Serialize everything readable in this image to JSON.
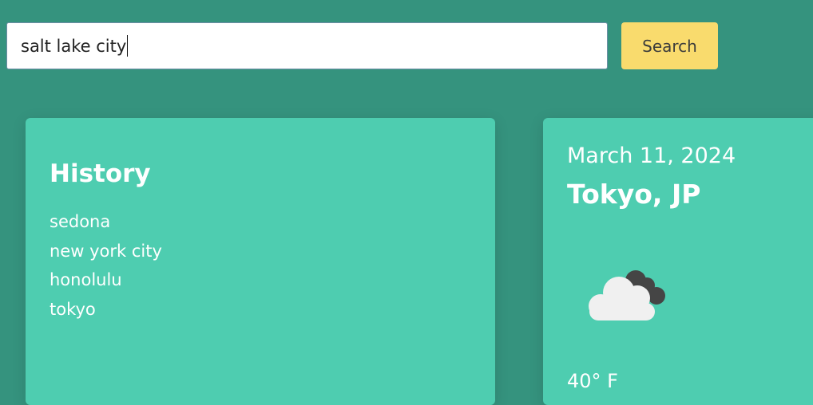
{
  "search": {
    "value": "salt lake city",
    "button_label": "Search"
  },
  "history": {
    "title": "History",
    "items": [
      "sedona",
      "new york city",
      "honolulu",
      "tokyo"
    ]
  },
  "weather": {
    "date": "March 11, 2024",
    "city": "Tokyo, JP",
    "icon": "cloudy-icon",
    "temperature": "40° F"
  },
  "colors": {
    "background": "#35937e",
    "card": "#4ecdb0",
    "button": "#f9db6d"
  }
}
